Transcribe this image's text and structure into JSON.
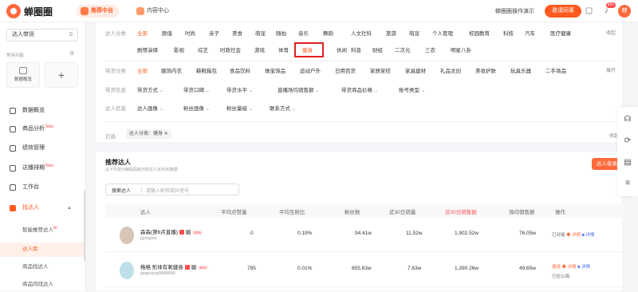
{
  "brand": {
    "name": "蝉圈圈"
  },
  "nav": {
    "tabs": [
      {
        "label": "推荐中台"
      },
      {
        "label": "内容中心"
      }
    ]
  },
  "topbar": {
    "account": "蝉圈圈操作演示",
    "invite_label": "邀请同事",
    "notice_count": "99+",
    "avatar_text": "蝉"
  },
  "sidebar": {
    "store_select": "达人带货",
    "shortcut_title": "常用功能",
    "shortcuts": [
      {
        "label": "数据概览"
      }
    ],
    "menu": [
      {
        "label": "数据概览"
      },
      {
        "label": "商品分析",
        "new": "New"
      },
      {
        "label": "绩效管理"
      },
      {
        "label": "达播排期",
        "new": "New"
      },
      {
        "label": "工作台"
      },
      {
        "label": "找达人"
      }
    ],
    "sub": [
      {
        "label": "智能推荐达人",
        "ai": "AI"
      },
      {
        "label": "达人库"
      },
      {
        "label": "商品找达人"
      },
      {
        "label": "商品同找达人"
      }
    ]
  },
  "filters": {
    "cat_label": "达人分类",
    "cats_row1": [
      "全部",
      "颜值",
      "时尚",
      "亲子",
      "美食",
      "萌宠",
      "随拍",
      "音乐",
      "舞蹈",
      "人文社科",
      "旅游",
      "萌宠",
      "个人管理",
      "校园教育",
      "科技",
      "汽车",
      "医疗健康"
    ],
    "cats_row2": [
      "剧情演绎",
      "影视",
      "综艺",
      "时政社会",
      "游戏",
      "体育",
      "健身",
      "休闲",
      "科普",
      "财经",
      "二次元",
      "三农",
      "明星八卦"
    ],
    "more_label": "收起",
    "goods_label": "带货分类",
    "goods": [
      "全部",
      "服饰内衣",
      "鞋靴箱包",
      "食品饮料",
      "珠宝饰品",
      "运动户外",
      "日用百货",
      "家居家纺",
      "家具建材",
      "礼品文创",
      "美妆护肤",
      "玩具乐器",
      "二手商品"
    ],
    "goods_more": "展开",
    "info_label": "带货信息",
    "info": [
      "带货方式",
      "带货口碑",
      "带货水平",
      "直播场均销售额",
      "带货商品价格",
      "账号类型"
    ],
    "person_label": "达人信息",
    "person": [
      "达人画像",
      "粉丝画像",
      "粉丝量级",
      "联系方式"
    ],
    "chosen_label": "已选",
    "chosen_chip": "达人分类：健身 ✕",
    "collapse_label": "收起"
  },
  "results": {
    "title": "推荐达人",
    "subtitle": "以下内容为蝉妈妈统计的达人近30天数据",
    "add_label": "达人收录",
    "search_type": "搜索达人",
    "search_placeholder": "请输入昵称或抖音号",
    "columns": [
      "达人",
      "平均点赞量",
      "平均互粉比",
      "粉丝数",
      "近30日销量",
      "近30日销售额",
      "场均销售额",
      "操作"
    ],
    "rows": [
      {
        "name": "森森(第6点直播)",
        "pct": "33%",
        "handle": "gymgirls",
        "likes": "0",
        "mutual": "0.19%",
        "fans": "94.41w",
        "sales": "11.52w",
        "revenue": "1,902.52w",
        "avg": "76.05w",
        "op1": "已对接",
        "op2": "详情",
        "op3": "详情"
      },
      {
        "name": "格格 形体有氧健身",
        "pct": "45%",
        "handle": "gegexing6888888",
        "likes": "785",
        "mutual": "0.01%",
        "fans": "855.63w",
        "sales": "7.63w",
        "revenue": "1,390.26w",
        "avg": "49.65w",
        "op1": "邀请",
        "op2": "详情",
        "op3": "详情",
        "op4": "已在公海"
      }
    ]
  },
  "colors": {
    "accent": "#ff5a1f",
    "highlight": "#e02020"
  }
}
